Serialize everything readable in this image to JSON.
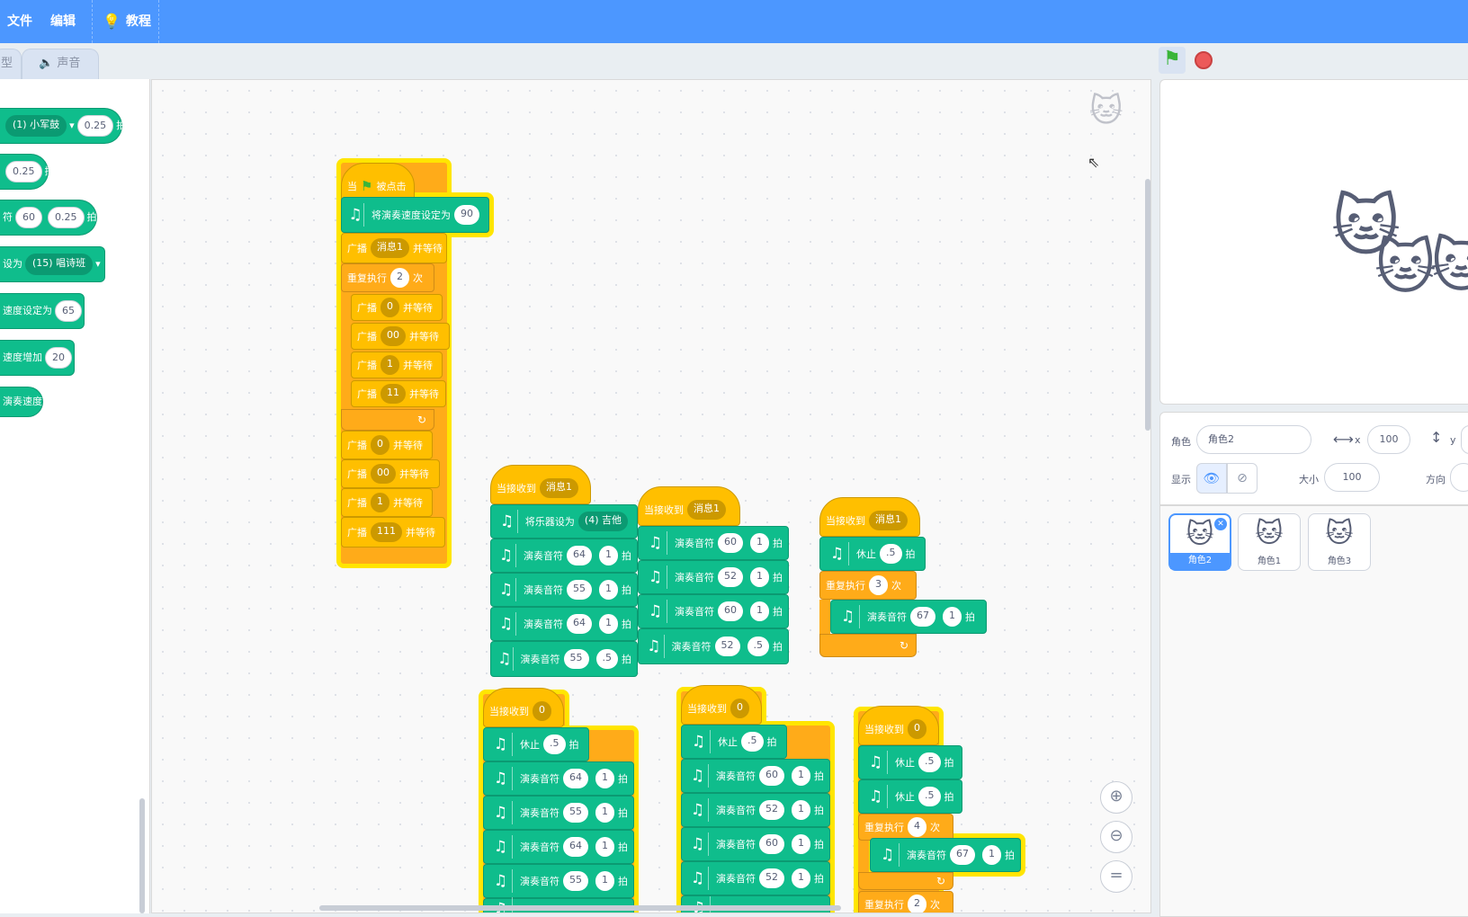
{
  "menu": {
    "file": "文件",
    "edit": "编辑",
    "tutorials": "教程"
  },
  "tabs": {
    "costumes_partial": "型",
    "sounds": "声音"
  },
  "palette": {
    "b1_drum": "(1) 小军鼓",
    "b1_beats": "0.25",
    "b1_suffix": "拍",
    "b2_beats": "0.25",
    "b2_suffix": "拍",
    "b3_prefix": "符",
    "b3_note": "60",
    "b3_beats": "0.25",
    "b3_suffix": "拍",
    "b4_prefix": "设为",
    "b4_instrument": "(15) 唱诗班",
    "b5_prefix": "速度设定为",
    "b5_value": "65",
    "b6_prefix": "速度增加",
    "b6_value": "20",
    "b7_label": "演奏速度"
  },
  "blocks": {
    "s1": {
      "hat_when": "当",
      "hat_clicked": "被点击",
      "tempo_label": "将演奏速度设定为",
      "tempo_value": "90",
      "bc1_label": "广播",
      "bc1_msg": "消息1",
      "bc1_wait": "并等待",
      "repeat_label": "重复执行",
      "repeat_count": "2",
      "repeat_times": "次",
      "r1_label": "广播",
      "r1_msg": "0",
      "r1_wait": "并等待",
      "r2_label": "广播",
      "r2_msg": "00",
      "r2_wait": "并等待",
      "r3_label": "广播",
      "r3_msg": "1",
      "r3_wait": "并等待",
      "r4_label": "广播",
      "r4_msg": "11",
      "r4_wait": "并等待",
      "a1_label": "广播",
      "a1_msg": "0",
      "a1_wait": "并等待",
      "a2_label": "广播",
      "a2_msg": "00",
      "a2_wait": "并等待",
      "a3_label": "广播",
      "a3_msg": "1",
      "a3_wait": "并等待",
      "a4_label": "广播",
      "a4_msg": "111",
      "a4_wait": "并等待"
    },
    "s2": {
      "hat": "当接收到",
      "msg": "消息1",
      "inst_label": "将乐器设为",
      "inst_value": "(4) 吉他",
      "play": "演奏音符",
      "beat": "拍",
      "n1": "64",
      "d1": "1",
      "n2": "55",
      "d2": "1",
      "n3": "64",
      "d3": "1",
      "n4": "55",
      "d4": ".5"
    },
    "s3": {
      "hat": "当接收到",
      "msg": "消息1",
      "play": "演奏音符",
      "beat": "拍",
      "n1": "60",
      "d1": "1",
      "n2": "52",
      "d2": "1",
      "n3": "60",
      "d3": "1",
      "n4": "52",
      "d4": ".5"
    },
    "s4": {
      "hat": "当接收到",
      "msg": "消息1",
      "rest": "休止",
      "rest_val": ".5",
      "beat": "拍",
      "repeat_label": "重复执行",
      "repeat_count": "3",
      "repeat_times": "次",
      "play": "演奏音符",
      "n1": "67",
      "d1": "1"
    },
    "s5": {
      "hat": "当接收到",
      "msg": "0",
      "rest": "休止",
      "rest_val": ".5",
      "play": "演奏音符",
      "beat": "拍",
      "n1": "64",
      "d1": "1",
      "n2": "55",
      "d2": "1",
      "n3": "64",
      "d3": "1",
      "n4": "55",
      "d4": "1"
    },
    "s6": {
      "hat": "当接收到",
      "msg": "0",
      "rest": "休止",
      "rest_val": ".5",
      "play": "演奏音符",
      "beat": "拍",
      "n1": "60",
      "d1": "1",
      "n2": "52",
      "d2": "1",
      "n3": "60",
      "d3": "1",
      "n4": "52",
      "d4": "1"
    },
    "s7": {
      "hat": "当接收到",
      "msg": "0",
      "rest": "休止",
      "rest_val1": ".5",
      "rest_val2": ".5",
      "beat": "拍",
      "repeat_label": "重复执行",
      "repeat_count": "4",
      "repeat_times": "次",
      "play": "演奏音符",
      "n1": "67",
      "d1": "1",
      "repeat2_count": "2",
      "repeat2_times": "次"
    }
  },
  "sprite_info": {
    "sprite_label": "角色",
    "sprite_name": "角色2",
    "x_label": "x",
    "x_value": "100",
    "y_label": "y",
    "show_label": "显示",
    "size_label": "大小",
    "size_value": "100",
    "direction_label": "方向"
  },
  "sprites": [
    "角色2",
    "角色1",
    "角色3"
  ],
  "colors": {
    "menu": "#4c97ff",
    "events": "#ffbf00",
    "control": "#ffab19",
    "music": "#0fbd8c",
    "glow": "#ffe500"
  }
}
